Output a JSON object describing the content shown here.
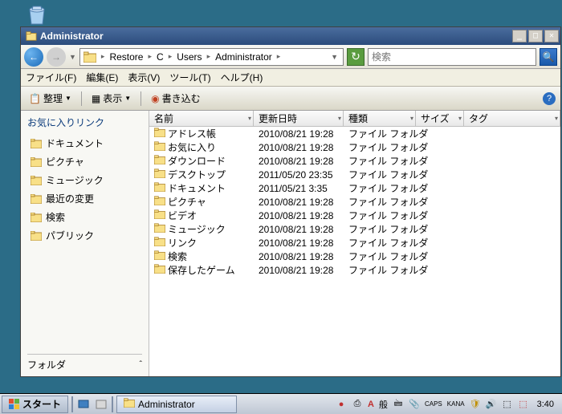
{
  "window": {
    "title": "Administrator"
  },
  "breadcrumb": {
    "parts": [
      "Restore",
      "C",
      "Users",
      "Administrator"
    ]
  },
  "search": {
    "placeholder": "検索"
  },
  "menubar": {
    "file": "ファイル(F)",
    "edit": "編集(E)",
    "view": "表示(V)",
    "tools": "ツール(T)",
    "help": "ヘルプ(H)"
  },
  "toolbar": {
    "organize": "整理",
    "views": "表示",
    "burn": "書き込む"
  },
  "sidebar": {
    "heading": "お気に入りリンク",
    "links": [
      {
        "label": "ドキュメント",
        "icon": "document"
      },
      {
        "label": "ピクチャ",
        "icon": "pictures"
      },
      {
        "label": "ミュージック",
        "icon": "music"
      },
      {
        "label": "最近の変更",
        "icon": "recent"
      },
      {
        "label": "検索",
        "icon": "search"
      },
      {
        "label": "パブリック",
        "icon": "public"
      }
    ],
    "folders": "フォルダ"
  },
  "columns": {
    "name": "名前",
    "date": "更新日時",
    "type": "種類",
    "size": "サイズ",
    "tags": "タグ"
  },
  "files": [
    {
      "name": "アドレス帳",
      "date": "2010/08/21 19:28",
      "type": "ファイル フォルダ"
    },
    {
      "name": "お気に入り",
      "date": "2010/08/21 19:28",
      "type": "ファイル フォルダ"
    },
    {
      "name": "ダウンロード",
      "date": "2010/08/21 19:28",
      "type": "ファイル フォルダ"
    },
    {
      "name": "デスクトップ",
      "date": "2011/05/20 23:35",
      "type": "ファイル フォルダ"
    },
    {
      "name": "ドキュメント",
      "date": "2011/05/21 3:35",
      "type": "ファイル フォルダ"
    },
    {
      "name": "ピクチャ",
      "date": "2010/08/21 19:28",
      "type": "ファイル フォルダ"
    },
    {
      "name": "ビデオ",
      "date": "2010/08/21 19:28",
      "type": "ファイル フォルダ"
    },
    {
      "name": "ミュージック",
      "date": "2010/08/21 19:28",
      "type": "ファイル フォルダ"
    },
    {
      "name": "リンク",
      "date": "2010/08/21 19:28",
      "type": "ファイル フォルダ"
    },
    {
      "name": "検索",
      "date": "2010/08/21 19:28",
      "type": "ファイル フォルダ"
    },
    {
      "name": "保存したゲーム",
      "date": "2010/08/21 19:28",
      "type": "ファイル フォルダ"
    }
  ],
  "taskbar": {
    "start": "スタート",
    "task": "Administrator",
    "ime_a": "A",
    "ime_mode": "般",
    "caps": "CAPS",
    "kana": "KANA",
    "clock": "3:40"
  }
}
